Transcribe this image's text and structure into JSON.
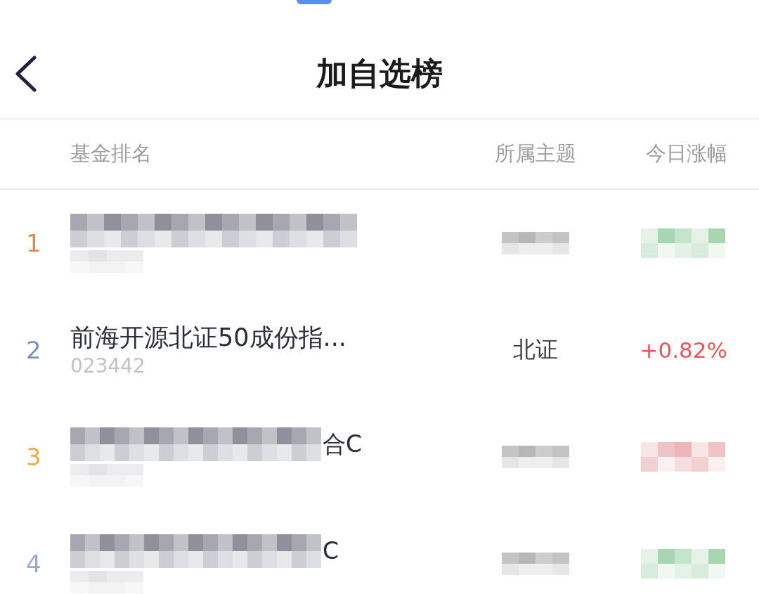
{
  "nav": {
    "title": "加自选榜"
  },
  "table": {
    "columns": [
      "基金排名",
      "所属主题",
      "今日涨幅"
    ],
    "rows": [
      {
        "kind": "blurred",
        "rank": "1",
        "color": "#e0894f",
        "rising": false
      },
      {
        "kind": "plain",
        "rank": "2",
        "color": "#7d90bd",
        "name": "前海开源北证50成份指...",
        "code": "023442",
        "theme": "北证",
        "change": "+0.82%",
        "rising": true
      },
      {
        "kind": "blurred",
        "rank": "3",
        "color": "#e8ae4c",
        "name_tail": "合C",
        "rising": true
      },
      {
        "kind": "blurred",
        "rank": "4",
        "color": "#9aabc9",
        "name_tail": "C",
        "rising": false
      }
    ]
  }
}
